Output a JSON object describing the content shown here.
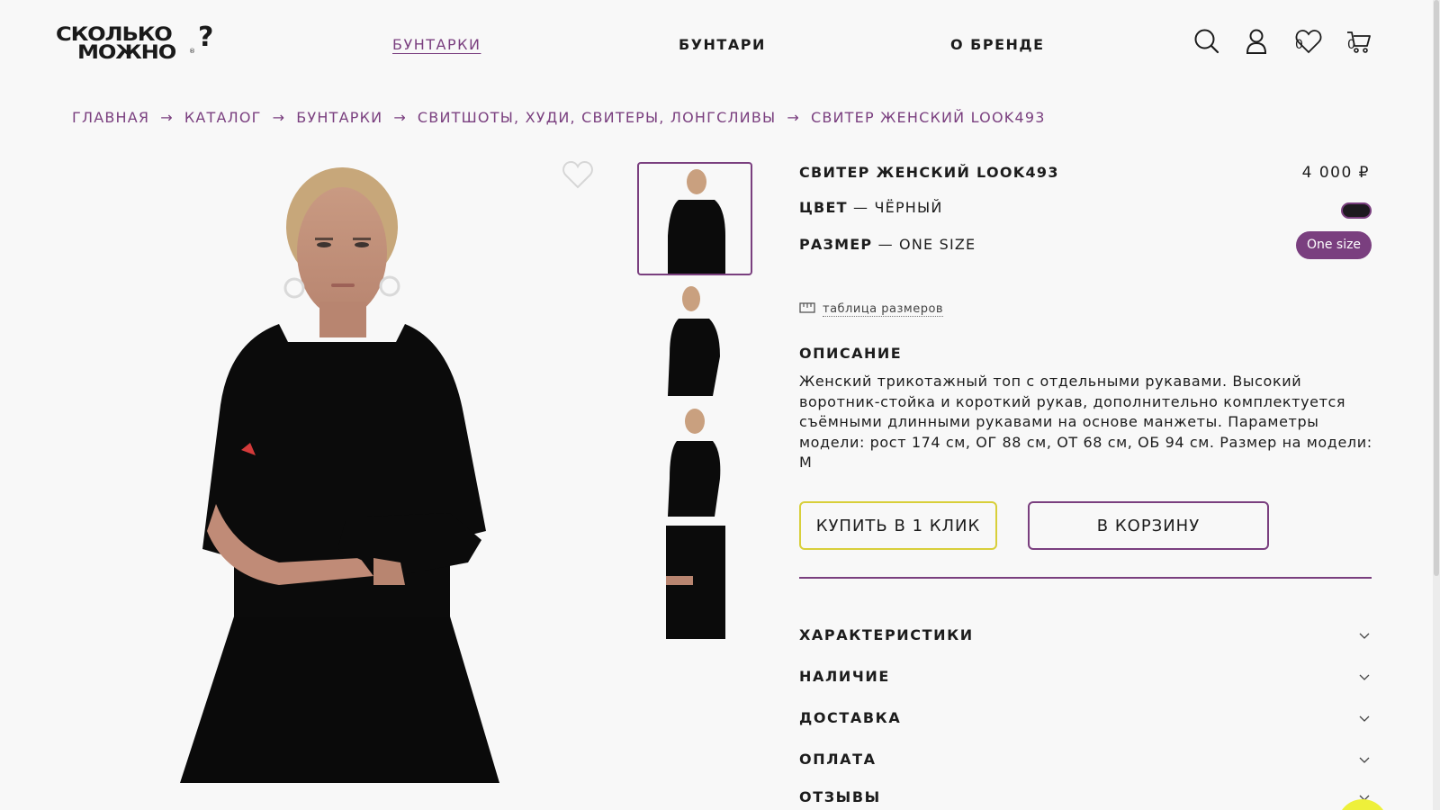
{
  "brand": {
    "line1": "СКОЛЬКО",
    "line2": "МОЖНО",
    "mark": "?"
  },
  "nav": [
    {
      "label": "БУНТАРКИ",
      "active": true
    },
    {
      "label": "БУНТАРИ",
      "active": false
    },
    {
      "label": "О БРЕНДЕ",
      "active": false
    }
  ],
  "header_icons": {
    "search": "search-icon",
    "account": "user-icon",
    "wishlist": {
      "icon": "heart-icon",
      "count": "0"
    },
    "cart": {
      "icon": "cart-icon",
      "count": "0"
    }
  },
  "breadcrumb": [
    "ГЛАВНАЯ",
    "КАТАЛОГ",
    "БУНТАРКИ",
    "СВИТШОТЫ, ХУДИ, СВИТЕРЫ, ЛОНГСЛИВЫ",
    "СВИТЕР ЖЕНСКИЙ LOOK493"
  ],
  "breadcrumb_sep": "→",
  "product": {
    "title": "СВИТЕР ЖЕНСКИЙ LOOK493",
    "price": "4 000 ₽",
    "color_label": "ЦВЕТ",
    "color_value": "— ЧЁРНЫЙ",
    "color_hex": "#1d1a1f",
    "size_label": "РАЗМЕР",
    "size_value": "— ONE SIZE",
    "size_option": "One size",
    "size_table_link": "таблица размеров",
    "description_heading": "ОПИСАНИЕ",
    "description": "Женский трикотажный топ с отдельными рукавами. Высокий воротник-стойка и короткий рукав, дополнительно комплектуется съёмными длинными рукавами на основе манжеты. Параметры модели: рост 174 см, ОГ 88 см, ОТ 68 см, ОБ 94 см. Размер на модели: M",
    "buy_one_click": "КУПИТЬ В 1 КЛИК",
    "add_to_cart": "В КОРЗИНУ"
  },
  "accordion": [
    "ХАРАКТЕРИСТИКИ",
    "НАЛИЧИЕ",
    "ДОСТАВКА",
    "ОПЛАТА",
    "ОТЗЫВЫ"
  ],
  "colors": {
    "accent": "#7a3f7f",
    "buy_border": "#d8cf3a",
    "background": "#f8f8f8",
    "fab": "#eef03a"
  }
}
